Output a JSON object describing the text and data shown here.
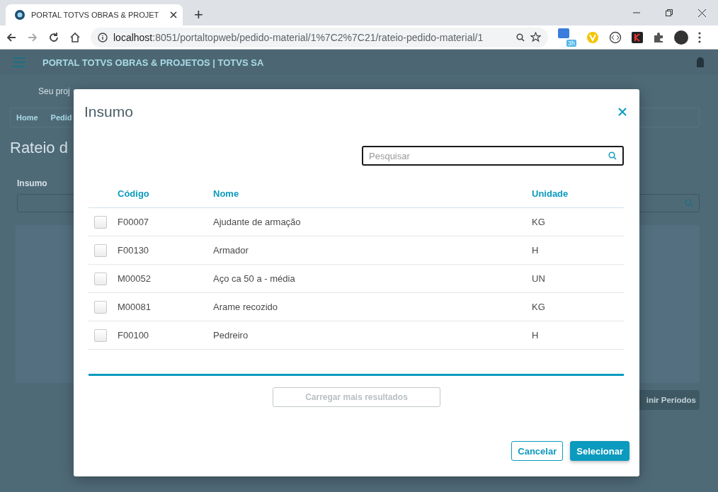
{
  "browser": {
    "tab_title": "PORTAL TOTVS OBRAS & PROJET",
    "new_tab": "+",
    "url_host": "localhost",
    "url_path": ":8051/portaltopweb/pedido-material/1%7C2%7C21/rateio-pedido-material/1",
    "extension_badge": "3h"
  },
  "page": {
    "app_title": "PORTAL TOTVS OBRAS & PROJETOS | TOTVS SA",
    "project_label": "Seu proj",
    "breadcrumb": [
      "Home",
      "Pedid"
    ],
    "page_title": "Rateio d",
    "field_label": "Insumo",
    "action_button": "inir Períodos"
  },
  "modal": {
    "title": "Insumo",
    "search": {
      "placeholder": "Pesquisar"
    },
    "columns": [
      "Código",
      "Nome",
      "Unidade"
    ],
    "rows": [
      {
        "code": "F00007",
        "name": "Ajudante de armação",
        "unit": "KG",
        "checked": false
      },
      {
        "code": "F00130",
        "name": "Armador",
        "unit": "H",
        "checked": false
      },
      {
        "code": "M00052",
        "name": "Aço ca 50 a - média",
        "unit": "UN",
        "checked": false
      },
      {
        "code": "M00081",
        "name": "Arame recozido",
        "unit": "KG",
        "checked": false
      },
      {
        "code": "F00100",
        "name": "Pedreiro",
        "unit": "H",
        "checked": false
      }
    ],
    "load_more": {
      "label": "Carregar mais resultados",
      "disabled": true
    },
    "buttons": [
      {
        "label": "Cancelar",
        "kind": "secondary"
      },
      {
        "label": "Selecionar",
        "kind": "primary"
      }
    ]
  }
}
